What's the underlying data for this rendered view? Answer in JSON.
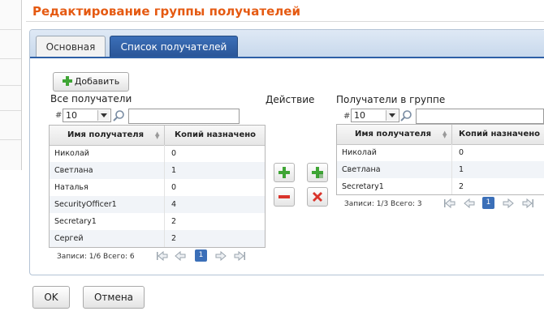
{
  "page": {
    "title": "Редактирование группы получателей"
  },
  "tabs": [
    {
      "label": "Основная",
      "active": false
    },
    {
      "label": "Список получателей",
      "active": true
    }
  ],
  "toolbar": {
    "add_label": "Добавить"
  },
  "all_recipients": {
    "title": "Все получатели",
    "per_page_prefix": "#",
    "per_page": "10",
    "search_value": "",
    "columns": [
      "Имя получателя",
      "Копий назначено"
    ],
    "rows": [
      [
        "Николай",
        "0"
      ],
      [
        "Светлана",
        "1"
      ],
      [
        "Наталья",
        "0"
      ],
      [
        "SecurityOfficer1",
        "4"
      ],
      [
        "Secretary1",
        "2"
      ],
      [
        "Сергей",
        "2"
      ]
    ],
    "pager": {
      "summary": "Записи: 1/6 Всего: 6",
      "current_page": "1"
    }
  },
  "actions": {
    "title": "Действие"
  },
  "group_recipients": {
    "title": "Получатели в группе",
    "per_page_prefix": "#",
    "per_page": "10",
    "search_value": "",
    "columns": [
      "Имя получателя",
      "Копий назначено"
    ],
    "rows": [
      [
        "Николай",
        "0"
      ],
      [
        "Светлана",
        "1"
      ],
      [
        "Secretary1",
        "2"
      ]
    ],
    "pager": {
      "summary": "Записи: 1/3 Всего: 3",
      "current_page": "1"
    }
  },
  "footer": {
    "ok_label": "OK",
    "cancel_label": "Отмена"
  },
  "colors": {
    "accent_orange": "#e55a12",
    "tab_blue": "#2d5fa6",
    "plus_green": "#3fa535",
    "minus_red": "#d9332a"
  },
  "icons": [
    "add-icon",
    "search-icon",
    "dropdown-arrow-icon",
    "sort-icon",
    "first-page-icon",
    "prev-page-icon",
    "next-page-icon",
    "last-page-icon",
    "add-selected-icon",
    "add-all-icon",
    "remove-selected-icon",
    "remove-all-icon"
  ]
}
